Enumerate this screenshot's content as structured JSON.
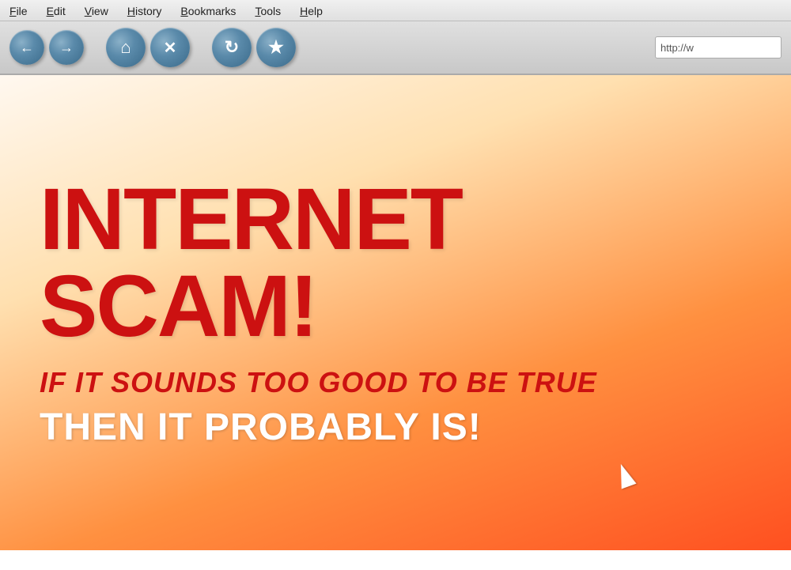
{
  "browser": {
    "menu": {
      "items": [
        {
          "id": "file",
          "label": "File",
          "underline": "F"
        },
        {
          "id": "edit",
          "label": "Edit",
          "underline": "E"
        },
        {
          "id": "view",
          "label": "View",
          "underline": "V"
        },
        {
          "id": "history",
          "label": "History",
          "underline": "H"
        },
        {
          "id": "bookmarks",
          "label": "Bookmarks",
          "underline": "B"
        },
        {
          "id": "tools",
          "label": "Tools",
          "underline": "T"
        },
        {
          "id": "help",
          "label": "Help",
          "underline": "H"
        }
      ]
    },
    "toolbar": {
      "back_btn": "←",
      "forward_btn": "→",
      "home_btn": "⌂",
      "stop_btn": "✕",
      "refresh_btn": "↻",
      "bookmark_btn": "★"
    },
    "address_bar": {
      "value": "http://w",
      "placeholder": "http://w"
    }
  },
  "page": {
    "headline": "INTERNET SCAM!",
    "subheadline": "IF IT SOUNDS TOO GOOD TO BE TRUE",
    "tagline": "THEN IT PROBABLY IS!"
  }
}
